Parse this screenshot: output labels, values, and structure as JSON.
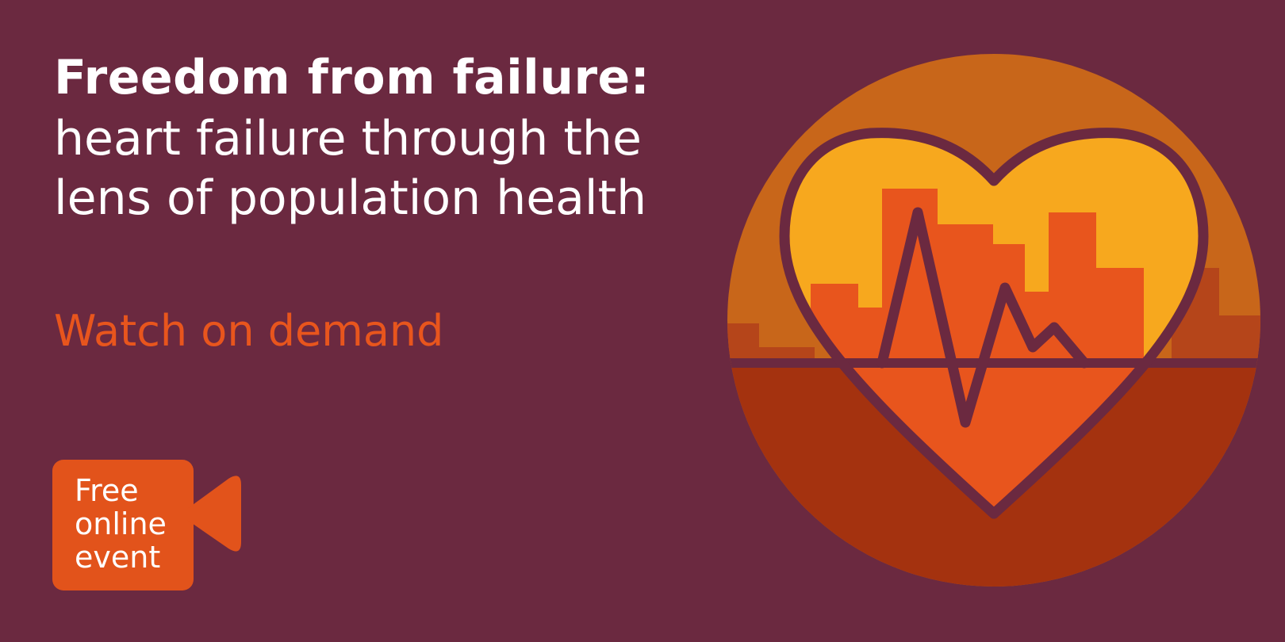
{
  "headline": {
    "title": "Freedom from failure:",
    "subtitle_line_1": "heart failure through the",
    "subtitle_line_2": "lens of population health"
  },
  "cta": {
    "label": "Watch on demand"
  },
  "badge": {
    "line_1": "Free",
    "line_2": "online",
    "line_3": "event",
    "icon": "video-camera-icon"
  },
  "emblem": {
    "icon": "heart-heartbeat-skyline-icon"
  },
  "colors": {
    "background": "#6b2940",
    "accent_orange": "#e8551d",
    "amber": "#c8661a",
    "yellow": "#f7a81e",
    "dark_orange": "#a4320f",
    "white": "#ffffff"
  }
}
